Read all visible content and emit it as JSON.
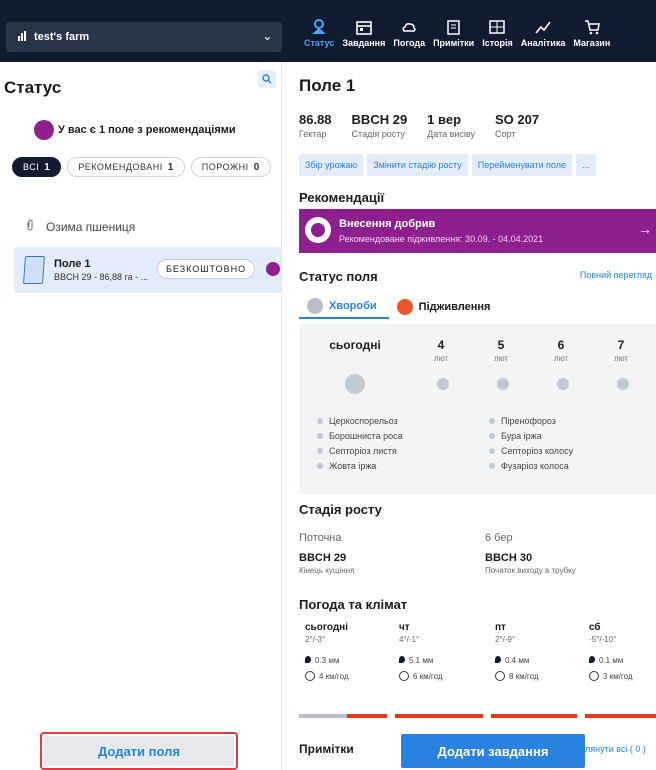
{
  "farm": {
    "name": "test's farm"
  },
  "nav": [
    {
      "label": "Статус",
      "icon": "status-icon",
      "active": true
    },
    {
      "label": "Завдання",
      "icon": "calendar-icon",
      "active": false
    },
    {
      "label": "Погода",
      "icon": "weather-icon",
      "active": false
    },
    {
      "label": "Примітки",
      "icon": "notes-icon",
      "active": false
    },
    {
      "label": "Історія",
      "icon": "history-icon",
      "active": false
    },
    {
      "label": "Аналітика",
      "icon": "analytics-icon",
      "active": false
    },
    {
      "label": "Магазин",
      "icon": "cart-icon",
      "active": false
    }
  ],
  "left": {
    "title": "Статус",
    "reco_text": "У вас є 1 поле з рекомендаціями",
    "filters": [
      {
        "label": "ВСІ",
        "count": "1",
        "active": true
      },
      {
        "label": "РЕКОМЕНДОВАНІ",
        "count": "1",
        "active": false
      },
      {
        "label": "ПОРОЖНІ",
        "count": "0",
        "active": false
      }
    ],
    "crop": "Озима пшениця",
    "field": {
      "name": "Поле 1",
      "sub": "BBCH 29 - 86,88 га - ...",
      "badge": "БЕЗКОШТОВНО"
    },
    "add_fields": "Додати поля"
  },
  "right": {
    "title": "Поле 1",
    "stats": [
      {
        "value": "86.88",
        "label": "Гектар"
      },
      {
        "value": "BBCH 29",
        "label": "Стадія росту"
      },
      {
        "value": "1 вер",
        "label": "Дата висіву"
      },
      {
        "value": "SO 207",
        "label": "Сорт"
      }
    ],
    "actions": [
      "Збір урожаю",
      "Змінити стадію росту",
      "Перейменувати поле",
      "..."
    ],
    "recommendations_title": "Рекомендації",
    "rec": {
      "title": "Внесення добрив",
      "sub": "Рекомендоване підживлення: 30.09. - 04.04.2021",
      "arrow": "→"
    },
    "field_status_title": "Статус поля",
    "full_view": "Повний перегляд",
    "tabs": [
      {
        "label": "Хвороби",
        "active": true,
        "color": "#b9bec6"
      },
      {
        "label": "Підживлення",
        "active": false,
        "color": "#f0522d"
      }
    ],
    "calendar": [
      {
        "day": "сьогодні",
        "month": ""
      },
      {
        "day": "4",
        "month": "лют"
      },
      {
        "day": "5",
        "month": "лют"
      },
      {
        "day": "6",
        "month": "лют"
      },
      {
        "day": "7",
        "month": "лют"
      }
    ],
    "diseases_left": [
      "Церкоспорельоз",
      "Борошниста роса",
      "Септоріоз листя",
      "Жовта іржа"
    ],
    "diseases_right": [
      "Піренофороз",
      "Бура іржа",
      "Септоріоз колосу",
      "Фузаріоз колоса"
    ],
    "growth_title": "Стадія росту",
    "growth": [
      {
        "when": "Поточна",
        "stage": "BBCH 29",
        "desc": "Кінець кущіння"
      },
      {
        "when": "6 бер",
        "stage": "BBCH 30",
        "desc": "Початок виходу в трубку"
      }
    ],
    "weather_title": "Погода та клімат",
    "weather": [
      {
        "day": "сьогодні",
        "temp": "2°/-3°",
        "precip": "0.3 мм",
        "wind": "4 км/год"
      },
      {
        "day": "чт",
        "temp": "4°/-1°",
        "precip": "5.1 мм",
        "wind": "6 км/год"
      },
      {
        "day": "пт",
        "temp": "2°/-9°",
        "precip": "0.4 мм",
        "wind": "8 км/год"
      },
      {
        "day": "сб",
        "temp": "-5°/-10°",
        "precip": "0.1 мм",
        "wind": "3 км/год"
      }
    ],
    "notes_title": "Примітки",
    "add_task": "Додати завдання",
    "show_all": "лянути всі ( 0 )"
  },
  "colors": {
    "accent": "#2a82e0",
    "purple": "#8e1f8e",
    "alert": "#e03b46",
    "topbar": "#121c30"
  }
}
